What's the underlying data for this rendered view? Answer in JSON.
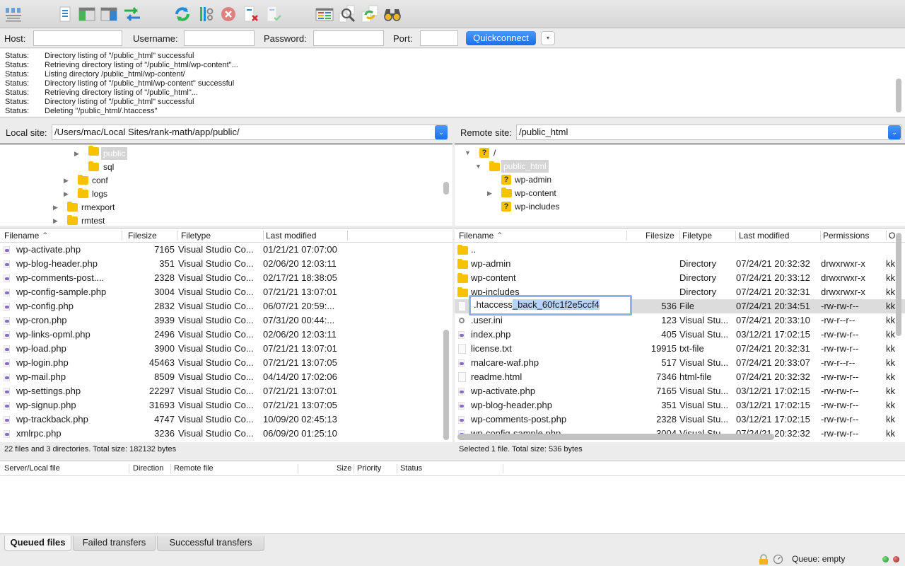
{
  "toolbar": {
    "icons": [
      "site-manager-icon",
      "toggle-message-log-icon",
      "toggle-local-tree-icon",
      "toggle-remote-tree-icon",
      "toggle-transfer-queue-icon",
      "refresh-icon",
      "process-queue-icon",
      "cancel-operation-icon",
      "disconnect-icon",
      "reconnect-icon",
      "directory-comparison-icon",
      "toggle-filter-icon",
      "synchronized-browsing-icon",
      "search-remote-files-icon"
    ]
  },
  "quickconnect": {
    "host_label": "Host:",
    "host_value": "",
    "username_label": "Username:",
    "username_value": "",
    "password_label": "Password:",
    "password_value": "",
    "port_label": "Port:",
    "port_value": "",
    "button_label": "Quickconnect",
    "dropdown_glyph": "▾"
  },
  "log": [
    {
      "key": "Status:",
      "text": "Directory listing of \"/public_html\" successful"
    },
    {
      "key": "Status:",
      "text": "Retrieving directory listing of \"/public_html/wp-content\"..."
    },
    {
      "key": "Status:",
      "text": "Listing directory /public_html/wp-content/"
    },
    {
      "key": "Status:",
      "text": "Directory listing of \"/public_html/wp-content\" successful"
    },
    {
      "key": "Status:",
      "text": "Retrieving directory listing of \"/public_html\"..."
    },
    {
      "key": "Status:",
      "text": "Directory listing of \"/public_html\" successful"
    },
    {
      "key": "Status:",
      "text": "Deleting \"/public_html/.htaccess\""
    }
  ],
  "local": {
    "site_label": "Local site:",
    "path": "/Users/mac/Local Sites/rank-math/app/public/",
    "tree": [
      {
        "name": "public",
        "selected": true,
        "expandable": true
      },
      {
        "name": "sql",
        "selected": false,
        "expandable": false
      },
      {
        "name": "conf",
        "selected": false,
        "expandable": true
      },
      {
        "name": "logs",
        "selected": false,
        "expandable": true
      },
      {
        "name": "rmexport",
        "selected": false,
        "expandable": true
      },
      {
        "name": "rmtest",
        "selected": false,
        "expandable": true
      }
    ],
    "columns": {
      "filename": "Filename",
      "filesize": "Filesize",
      "filetype": "Filetype",
      "modified": "Last modified"
    },
    "files": [
      {
        "name": "wp-activate.php",
        "size": "7165",
        "type": "Visual Studio Co...",
        "modified": "01/21/21 07:07:00"
      },
      {
        "name": "wp-blog-header.php",
        "size": "351",
        "type": "Visual Studio Co...",
        "modified": "02/06/20 12:03:11"
      },
      {
        "name": "wp-comments-post....",
        "size": "2328",
        "type": "Visual Studio Co...",
        "modified": "02/17/21 18:38:05"
      },
      {
        "name": "wp-config-sample.php",
        "size": "3004",
        "type": "Visual Studio Co...",
        "modified": "07/21/21 13:07:01"
      },
      {
        "name": "wp-config.php",
        "size": "2832",
        "type": "Visual Studio Co...",
        "modified": "06/07/21 20:59:..."
      },
      {
        "name": "wp-cron.php",
        "size": "3939",
        "type": "Visual Studio Co...",
        "modified": "07/31/20 00:44:..."
      },
      {
        "name": "wp-links-opml.php",
        "size": "2496",
        "type": "Visual Studio Co...",
        "modified": "02/06/20 12:03:11"
      },
      {
        "name": "wp-load.php",
        "size": "3900",
        "type": "Visual Studio Co...",
        "modified": "07/21/21 13:07:01"
      },
      {
        "name": "wp-login.php",
        "size": "45463",
        "type": "Visual Studio Co...",
        "modified": "07/21/21 13:07:05"
      },
      {
        "name": "wp-mail.php",
        "size": "8509",
        "type": "Visual Studio Co...",
        "modified": "04/14/20 17:02:06"
      },
      {
        "name": "wp-settings.php",
        "size": "22297",
        "type": "Visual Studio Co...",
        "modified": "07/21/21 13:07:01"
      },
      {
        "name": "wp-signup.php",
        "size": "31693",
        "type": "Visual Studio Co...",
        "modified": "07/21/21 13:07:05"
      },
      {
        "name": "wp-trackback.php",
        "size": "4747",
        "type": "Visual Studio Co...",
        "modified": "10/09/20 02:45:13"
      },
      {
        "name": "xmlrpc.php",
        "size": "3236",
        "type": "Visual Studio Co...",
        "modified": "06/09/20 01:25:10"
      }
    ],
    "status": "22 files and 3 directories. Total size: 182132 bytes"
  },
  "remote": {
    "site_label": "Remote site:",
    "path": "/public_html",
    "tree": [
      {
        "name": "/",
        "icon": "unknown",
        "expanded": true
      },
      {
        "name": "public_html",
        "icon": "folder",
        "expanded": true,
        "selected": true
      },
      {
        "name": "wp-admin",
        "icon": "unknown"
      },
      {
        "name": "wp-content",
        "icon": "folder",
        "expandable": true
      },
      {
        "name": "wp-includes",
        "icon": "unknown"
      }
    ],
    "columns": {
      "filename": "Filename",
      "filesize": "Filesize",
      "filetype": "Filetype",
      "modified": "Last modified",
      "permissions": "Permissions",
      "owner": "O"
    },
    "files": [
      {
        "name": "..",
        "size": "",
        "type": "",
        "modified": "",
        "perms": "",
        "owner": "",
        "icon": "folder"
      },
      {
        "name": "wp-admin",
        "size": "",
        "type": "Directory",
        "modified": "07/24/21 20:32:32",
        "perms": "drwxrwxr-x",
        "owner": "kk",
        "icon": "folder"
      },
      {
        "name": "wp-content",
        "size": "",
        "type": "Directory",
        "modified": "07/24/21 20:33:12",
        "perms": "drwxrwxr-x",
        "owner": "kk",
        "icon": "folder"
      },
      {
        "name": "wp-includes",
        "size": "",
        "type": "Directory",
        "modified": "07/24/21 20:32:31",
        "perms": "drwxrwxr-x",
        "owner": "kk",
        "icon": "folder"
      },
      {
        "name": ".htaccess_back_60fc1f2e5ccf4",
        "size": "536",
        "type": "File",
        "modified": "07/24/21 20:34:51",
        "perms": "-rw-rw-r--",
        "owner": "kk",
        "icon": "txt",
        "selected": true
      },
      {
        "name": ".user.ini",
        "size": "123",
        "type": "Visual Stu...",
        "modified": "07/24/21 20:33:10",
        "perms": "-rw-r--r--",
        "owner": "kk",
        "icon": "gear"
      },
      {
        "name": "index.php",
        "size": "405",
        "type": "Visual Stu...",
        "modified": "03/12/21 17:02:15",
        "perms": "-rw-rw-r--",
        "owner": "kk",
        "icon": "php"
      },
      {
        "name": "license.txt",
        "size": "19915",
        "type": "txt-file",
        "modified": "07/24/21 20:32:31",
        "perms": "-rw-rw-r--",
        "owner": "kk",
        "icon": "txt"
      },
      {
        "name": "malcare-waf.php",
        "size": "517",
        "type": "Visual Stu...",
        "modified": "07/24/21 20:33:07",
        "perms": "-rw-r--r--",
        "owner": "kk",
        "icon": "php"
      },
      {
        "name": "readme.html",
        "size": "7346",
        "type": "html-file",
        "modified": "07/24/21 20:32:32",
        "perms": "-rw-rw-r--",
        "owner": "kk",
        "icon": "txt"
      },
      {
        "name": "wp-activate.php",
        "size": "7165",
        "type": "Visual Stu...",
        "modified": "03/12/21 17:02:15",
        "perms": "-rw-rw-r--",
        "owner": "kk",
        "icon": "php"
      },
      {
        "name": "wp-blog-header.php",
        "size": "351",
        "type": "Visual Stu...",
        "modified": "03/12/21 17:02:15",
        "perms": "-rw-rw-r--",
        "owner": "kk",
        "icon": "php"
      },
      {
        "name": "wp-comments-post.php",
        "size": "2328",
        "type": "Visual Stu...",
        "modified": "03/12/21 17:02:15",
        "perms": "-rw-rw-r--",
        "owner": "kk",
        "icon": "php"
      },
      {
        "name": "wp-config-sample.php",
        "size": "3004",
        "type": "Visual Stu...",
        "modified": "07/24/21 20:32:32",
        "perms": "-rw-rw-r--",
        "owner": "kk",
        "icon": "php"
      }
    ],
    "rename_edit": {
      "prefix": ".htaccess",
      "selected_suffix": "_back_60fc1f2e5ccf4"
    },
    "status": "Selected 1 file. Total size: 536 bytes"
  },
  "queue": {
    "columns": [
      "Server/Local file",
      "Direction",
      "Remote file",
      "Size",
      "Priority",
      "Status"
    ],
    "tabs": [
      "Queued files",
      "Failed transfers",
      "Successful transfers"
    ],
    "active_tab": 0
  },
  "statusbar": {
    "queue_text": "Queue: empty"
  },
  "colors": {
    "accent": "#1a6ff0",
    "folder": "#f8c200",
    "selection": "#dcdcdc",
    "edit_selection": "#b6d3fb"
  }
}
